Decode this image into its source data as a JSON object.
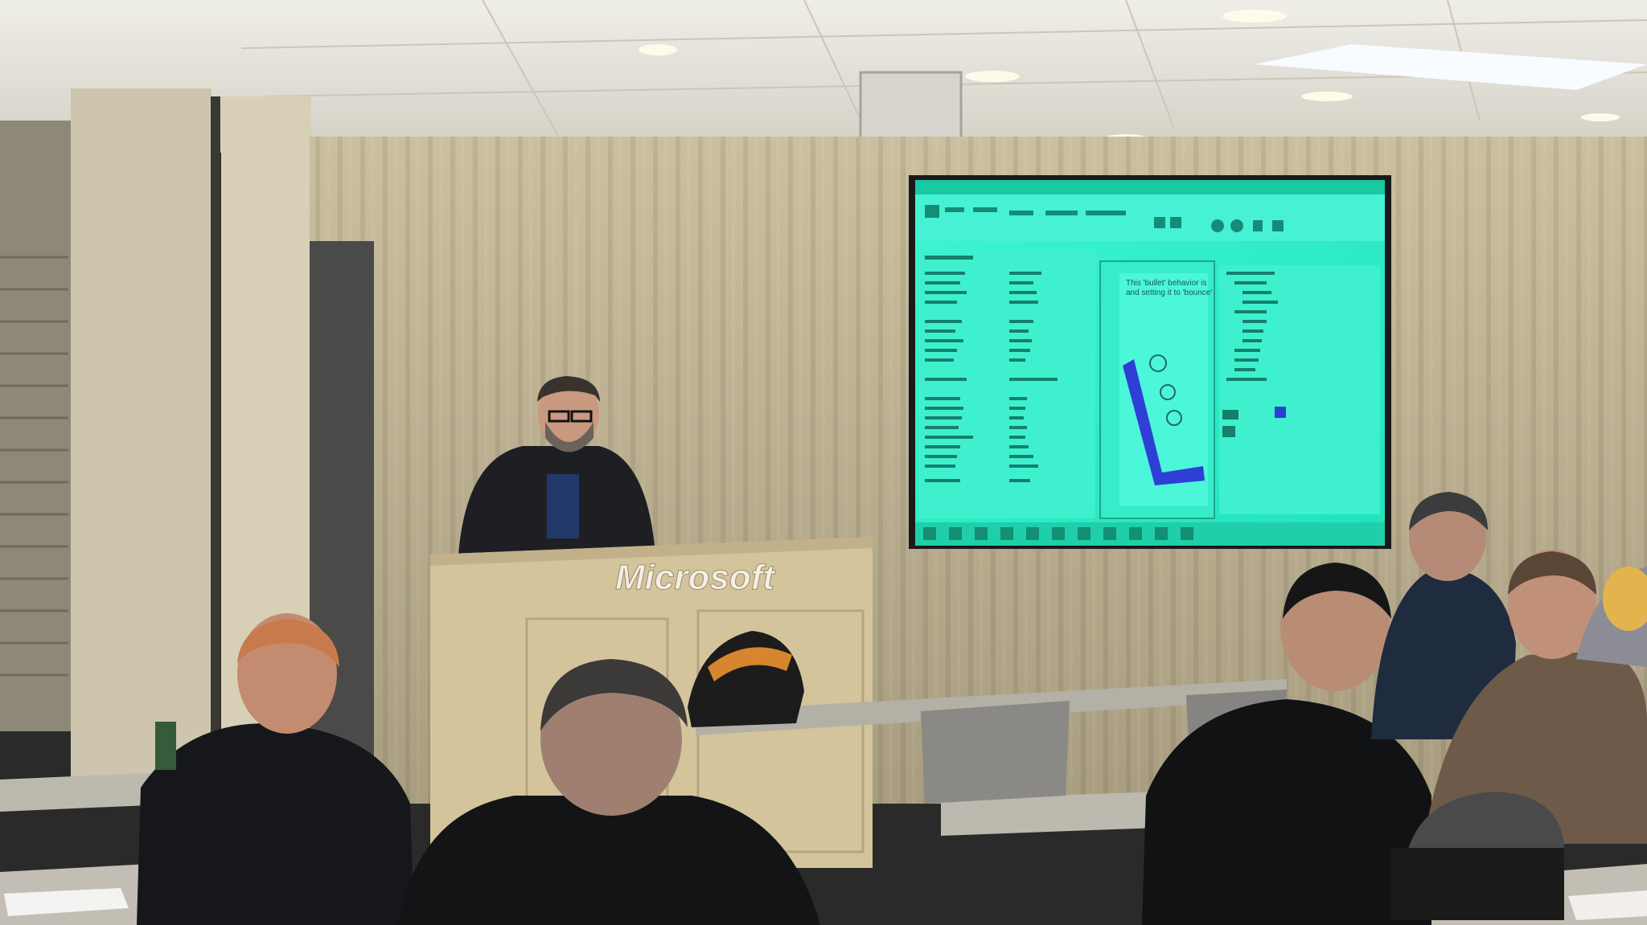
{
  "scene": {
    "podium_logo": "Microsoft",
    "slide_text_line1": "This 'bullet' behavior is",
    "slide_text_line2": "and setting it to 'bounce'"
  },
  "colors": {
    "screen": "#2ef0c8",
    "wall": "#b9ac8f",
    "curtain": "#c2b697",
    "ceiling": "#e6e4dc",
    "podium": "#d4c49c",
    "level_shape": "#2f3fd6"
  }
}
